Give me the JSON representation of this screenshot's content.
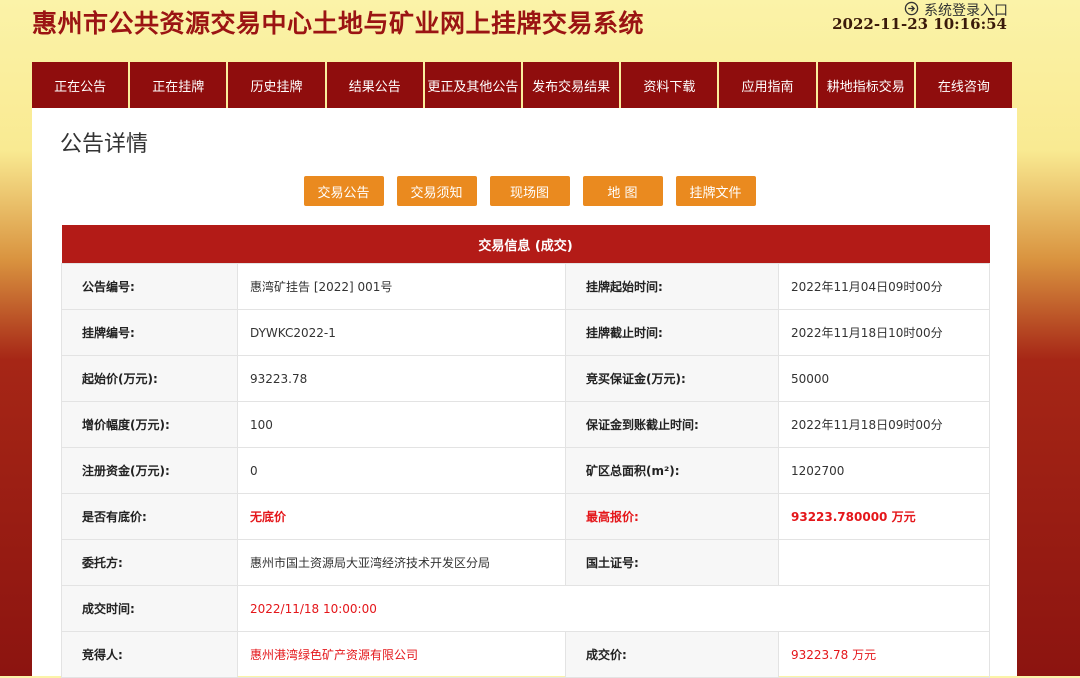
{
  "header": {
    "title": "惠州市公共资源交易中心土地与矿业网上挂牌交易系统",
    "login_label": "系统登录入口",
    "datetime": "2022-11-23 10:16:54"
  },
  "nav": {
    "items": [
      "正在公告",
      "正在挂牌",
      "历史挂牌",
      "结果公告",
      "更正及其他公告",
      "发布交易结果",
      "资料下载",
      "应用指南",
      "耕地指标交易",
      "在线咨询"
    ]
  },
  "page": {
    "title": "公告详情",
    "buttons": [
      "交易公告",
      "交易须知",
      "现场图",
      "地 图",
      "挂牌文件"
    ]
  },
  "table": {
    "header": "交易信息 (成交)",
    "rows": [
      {
        "l1": "公告编号:",
        "v1": "惠湾矿挂告 [2022] 001号",
        "l2": "挂牌起始时间:",
        "v2": "2022年11月04日09时00分"
      },
      {
        "l1": "挂牌编号:",
        "v1": "DYWKC2022-1",
        "l2": "挂牌截止时间:",
        "v2": "2022年11月18日10时00分"
      },
      {
        "l1": "起始价(万元):",
        "v1": "93223.78",
        "l2": "竞买保证金(万元):",
        "v2": "50000"
      },
      {
        "l1": "增价幅度(万元):",
        "v1": "100",
        "l2": "保证金到账截止时间:",
        "v2": "2022年11月18日09时00分"
      },
      {
        "l1": "注册资金(万元):",
        "v1": "0",
        "l2": "矿区总面积(m²):",
        "v2": "1202700"
      },
      {
        "l1": "是否有底价:",
        "v1": "无底价",
        "l2": "最高报价:",
        "v2": "93223.780000 万元"
      },
      {
        "l1": "委托方:",
        "v1": "惠州市国土资源局大亚湾经济技术开发区分局",
        "l2": "国土证号:",
        "v2": ""
      },
      {
        "l1": "成交时间:",
        "v1": "2022/11/18 10:00:00"
      },
      {
        "l1": "竞得人:",
        "v1": "惠州港湾绿色矿产资源有限公司",
        "l2": "成交价:",
        "v2": "93223.78 万元"
      }
    ]
  },
  "colors": {
    "nav_bg": "#8f0d0d",
    "button_bg": "#ea8a1f",
    "table_header_bg": "#b31b17",
    "highlight_text": "#e4161a"
  },
  "icons": {
    "login": "login-arrow-icon"
  }
}
